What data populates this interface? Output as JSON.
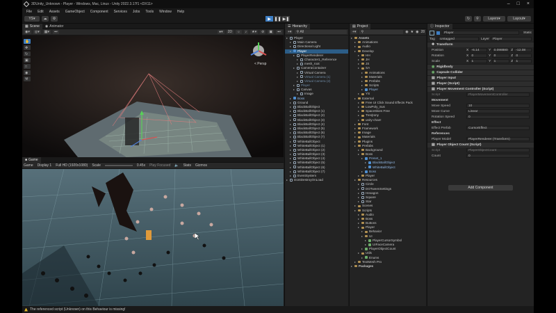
{
  "window": {
    "title": "3DUnity_Unknown - Player - Windows, Mac, Linux - Unity 2022.3.17f1 <DX11>"
  },
  "menu": [
    "File",
    "Edit",
    "Assets",
    "GameObject",
    "Component",
    "Services",
    "Jobs",
    "Tools",
    "Window",
    "Help"
  ],
  "toolbar": {
    "account": "YS",
    "layers": "Layers",
    "layout": "Layout"
  },
  "scene": {
    "tabs": [
      "Scene",
      "Animator"
    ],
    "persp": "< Persp"
  },
  "game": {
    "tab": "Game",
    "mode": "Game",
    "display": "Display 1",
    "resolution": "Full HD (1920x1080)",
    "scale_label": "Scale",
    "scale_value": "0.45x",
    "play_focused": "Play Focused",
    "stats": "Stats",
    "gizmos": "Gizmos"
  },
  "hierarchy": {
    "tab": "Hierarchy",
    "search": "All",
    "items": [
      {
        "t": "Player",
        "d": 0,
        "ic": "go"
      },
      {
        "t": "Main Camera",
        "d": 1,
        "ic": "go"
      },
      {
        "t": "Directional Light",
        "d": 1,
        "ic": "go"
      },
      {
        "t": "Player",
        "d": 1,
        "ic": "pf",
        "sel": true
      },
      {
        "t": "PlayerRenderer",
        "d": 2,
        "ic": "go"
      },
      {
        "t": "Character1_Reference",
        "d": 3,
        "ic": "go"
      },
      {
        "t": "mesh_root",
        "d": 3,
        "ic": "go"
      },
      {
        "t": "CameraContainer",
        "d": 2,
        "ic": "go"
      },
      {
        "t": "Virtual Camera",
        "d": 3,
        "ic": "go"
      },
      {
        "t": "Virtual Camera (1)",
        "d": 3,
        "ic": "go",
        "dim": true
      },
      {
        "t": "Virtual Camera (2)",
        "d": 3,
        "ic": "go",
        "dim": true
      },
      {
        "t": "Player",
        "d": 2,
        "ic": "go",
        "dim": true
      },
      {
        "t": "Canvas",
        "d": 2,
        "ic": "go"
      },
      {
        "t": "Image",
        "d": 3,
        "ic": "go"
      },
      {
        "t": "Boss",
        "d": 1,
        "ic": "pf"
      },
      {
        "t": "Ground",
        "d": 1,
        "ic": "go"
      },
      {
        "t": "BlackBallObject",
        "d": 1,
        "ic": "go"
      },
      {
        "t": "BlackBallObject (1)",
        "d": 1,
        "ic": "go"
      },
      {
        "t": "BlackBallObject (2)",
        "d": 1,
        "ic": "go"
      },
      {
        "t": "BlackBallObject (3)",
        "d": 1,
        "ic": "go"
      },
      {
        "t": "BlackBallObject (4)",
        "d": 1,
        "ic": "go"
      },
      {
        "t": "BlackBallObject (5)",
        "d": 1,
        "ic": "go"
      },
      {
        "t": "BlackBallObject (6)",
        "d": 1,
        "ic": "go"
      },
      {
        "t": "BlackBallObject (7)",
        "d": 1,
        "ic": "go"
      },
      {
        "t": "WhiteBallObject",
        "d": 1,
        "ic": "go"
      },
      {
        "t": "WhiteBallObject (1)",
        "d": 1,
        "ic": "go"
      },
      {
        "t": "WhiteBallObject (2)",
        "d": 1,
        "ic": "go"
      },
      {
        "t": "WhiteBallObject (3)",
        "d": 1,
        "ic": "go"
      },
      {
        "t": "WhiteBallObject (4)",
        "d": 1,
        "ic": "go"
      },
      {
        "t": "WhiteBallObject (5)",
        "d": 1,
        "ic": "go"
      },
      {
        "t": "WhiteBallObject (6)",
        "d": 1,
        "ic": "go"
      },
      {
        "t": "WhiteBallObject (7)",
        "d": 1,
        "ic": "go"
      },
      {
        "t": "EventSystem",
        "d": 1,
        "ic": "go"
      },
      {
        "t": "DontDestroyOnLoad",
        "d": 0,
        "ic": "go"
      }
    ]
  },
  "project": {
    "tab": "Project",
    "count": "28",
    "items": [
      {
        "t": "Assets",
        "d": 0,
        "ic": "fd",
        "b": true
      },
      {
        "t": "Animations",
        "d": 1,
        "ic": "fd"
      },
      {
        "t": "Audio",
        "d": 1,
        "ic": "fd"
      },
      {
        "t": "Develop",
        "d": 1,
        "ic": "fd"
      },
      {
        "t": "HH",
        "d": 2,
        "ic": "fd"
      },
      {
        "t": "JH",
        "d": 2,
        "ic": "fd"
      },
      {
        "t": "JS",
        "d": 2,
        "ic": "fd"
      },
      {
        "t": "SA",
        "d": 2,
        "ic": "fd"
      },
      {
        "t": "Animations",
        "d": 3,
        "ic": "fd"
      },
      {
        "t": "Materials",
        "d": 3,
        "ic": "fd"
      },
      {
        "t": "Prefabs",
        "d": 3,
        "ic": "fd"
      },
      {
        "t": "Scripts",
        "d": 3,
        "ic": "fd"
      },
      {
        "t": "Player",
        "d": 3,
        "ic": "pf"
      },
      {
        "t": "YS",
        "d": 2,
        "ic": "fd"
      },
      {
        "t": "External",
        "d": 1,
        "ic": "fd"
      },
      {
        "t": "Free UI Click Sound Effects Pack",
        "d": 2,
        "ic": "fd"
      },
      {
        "t": "LowPoly_Sus",
        "d": 2,
        "ic": "fd"
      },
      {
        "t": "SpaceSkies Free",
        "d": 2,
        "ic": "fd"
      },
      {
        "t": "Trenjtony",
        "d": 2,
        "ic": "fd"
      },
      {
        "t": "unity-chan!",
        "d": 2,
        "ic": "fd"
      },
      {
        "t": "Font",
        "d": 1,
        "ic": "fd"
      },
      {
        "t": "Framework",
        "d": 1,
        "ic": "fd"
      },
      {
        "t": "Image",
        "d": 1,
        "ic": "fd"
      },
      {
        "t": "Materials",
        "d": 1,
        "ic": "fd"
      },
      {
        "t": "Plugins",
        "d": 1,
        "ic": "fd"
      },
      {
        "t": "Prefabs",
        "d": 1,
        "ic": "fd"
      },
      {
        "t": "Background",
        "d": 2,
        "ic": "fd"
      },
      {
        "t": "Boss",
        "d": 2,
        "ic": "fd"
      },
      {
        "t": "Preset_1",
        "d": 3,
        "ic": "pf"
      },
      {
        "t": "BlackBallObject",
        "d": 4,
        "ic": "pf"
      },
      {
        "t": "WhiteBallObject",
        "d": 4,
        "ic": "pf"
      },
      {
        "t": "Boss",
        "d": 3,
        "ic": "pf"
      },
      {
        "t": "Player",
        "d": 2,
        "ic": "fd"
      },
      {
        "t": "Resources",
        "d": 1,
        "ic": "fd"
      },
      {
        "t": "Circle",
        "d": 2,
        "ic": "go"
      },
      {
        "t": "DOTweenSettings",
        "d": 2,
        "ic": "go"
      },
      {
        "t": "Hexagon",
        "d": 2,
        "ic": "go"
      },
      {
        "t": "Square",
        "d": 2,
        "ic": "go"
      },
      {
        "t": "Star",
        "d": 2,
        "ic": "go"
      },
      {
        "t": "Scenes",
        "d": 1,
        "ic": "fd"
      },
      {
        "t": "Scripts",
        "d": 1,
        "ic": "fd"
      },
      {
        "t": "Audio",
        "d": 2,
        "ic": "fd"
      },
      {
        "t": "Boss",
        "d": 2,
        "ic": "fd"
      },
      {
        "t": "Buttons",
        "d": 2,
        "ic": "fd"
      },
      {
        "t": "Player",
        "d": 2,
        "ic": "fd"
      },
      {
        "t": "Behavior",
        "d": 3,
        "ic": "fd"
      },
      {
        "t": "UI",
        "d": 3,
        "ic": "fd"
      },
      {
        "t": "PlayerCursorSymbol",
        "d": 4,
        "ic": "sc"
      },
      {
        "t": "UIFaceCamera",
        "d": 4,
        "ic": "sc"
      },
      {
        "t": "PlayerObjectCount",
        "d": 3,
        "ic": "sc"
      },
      {
        "t": "Utils",
        "d": 2,
        "ic": "fd"
      },
      {
        "t": "Enums",
        "d": 3,
        "ic": "sc"
      },
      {
        "t": "TextMesh Pro",
        "d": 1,
        "ic": "fd"
      },
      {
        "t": "Packages",
        "d": 0,
        "ic": "fd",
        "b": true
      }
    ]
  },
  "inspector": {
    "tab": "Inspector",
    "name": "Player",
    "static": "Static",
    "tag_label": "Tag",
    "tag": "Untagged",
    "layer_label": "Layer",
    "layer": "Player",
    "transform": {
      "title": "Transform",
      "position_label": "Position",
      "rotation_label": "Rotation",
      "scale_label": "Scale",
      "pos": {
        "x": "-6.14",
        "y": "0.098880",
        "z": "-12.08"
      },
      "rot": {
        "x": "0",
        "y": "0",
        "z": "0"
      },
      "scale": {
        "x": "1",
        "y": "1",
        "z": "1"
      }
    },
    "components": [
      "Rigidbody",
      "Capsule Collider",
      "Player Input",
      "Player (Script)",
      "Player Movement Controller (Script)"
    ],
    "pmc": {
      "script_label": "Script",
      "script": "PlayerMovementController",
      "movement": "Movement",
      "move_speed_label": "Move Speed",
      "move_speed": "10",
      "move_curve_label": "Move Curve",
      "move_curve": "Linear",
      "rotation_speed_label": "Rotation Speed",
      "rotation_speed": "0",
      "effect": "Effect",
      "effect_prefab_label": "Effect Prefab",
      "effect_prefab": "CursorEffect",
      "references": "References",
      "player_model_label": "Player Model",
      "player_model": "PlayerRenderer (Transform)"
    },
    "poc": {
      "title": "Player Object Count (Script)",
      "script_label": "Script",
      "script": "PlayerObjectCount",
      "count_label": "Count",
      "count": "0"
    },
    "add_component": "Add Component"
  },
  "status": "The referenced script (Unknown) on this Behaviour is missing!"
}
